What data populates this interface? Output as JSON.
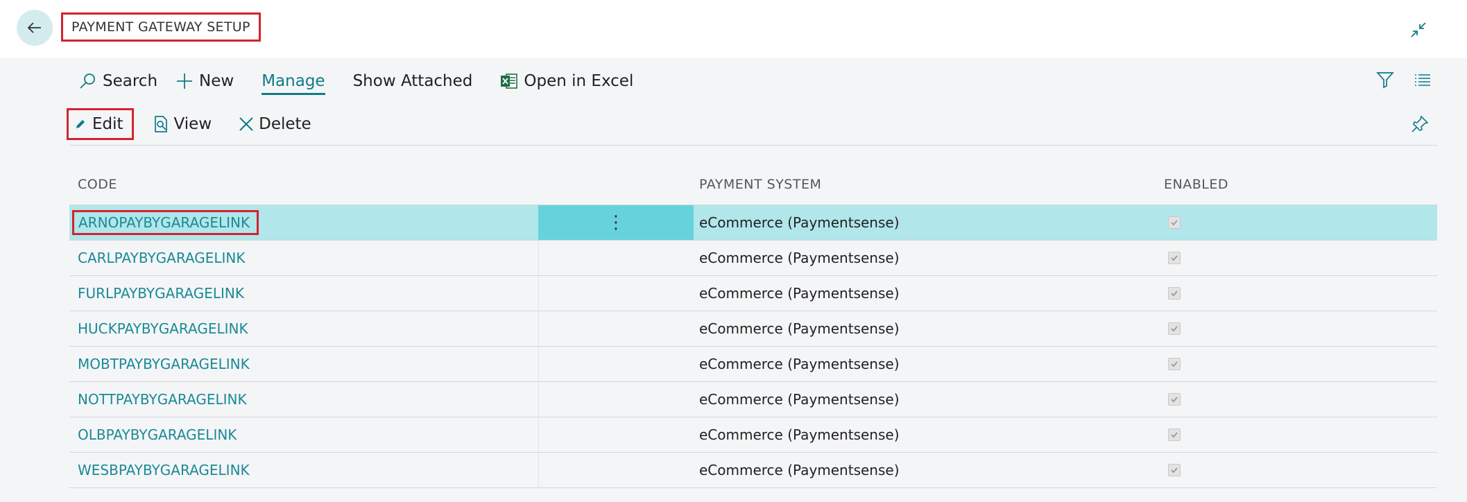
{
  "header": {
    "title": "PAYMENT GATEWAY SETUP"
  },
  "actions": {
    "search": "Search",
    "new": "New",
    "manage": "Manage",
    "show_attached": "Show Attached",
    "open_in_excel": "Open in Excel"
  },
  "subactions": {
    "edit": "Edit",
    "view": "View",
    "delete": "Delete"
  },
  "table": {
    "columns": [
      "CODE",
      "PAYMENT SYSTEM",
      "ENABLED"
    ],
    "rows": [
      {
        "code": "ARNOPAYBYGARAGELINK",
        "system": "eCommerce (Paymentsense)",
        "enabled": true
      },
      {
        "code": "CARLPAYBYGARAGELINK",
        "system": "eCommerce (Paymentsense)",
        "enabled": true
      },
      {
        "code": "FURLPAYBYGARAGELINK",
        "system": "eCommerce (Paymentsense)",
        "enabled": true
      },
      {
        "code": "HUCKPAYBYGARAGELINK",
        "system": "eCommerce (Paymentsense)",
        "enabled": true
      },
      {
        "code": "MOBTPAYBYGARAGELINK",
        "system": "eCommerce (Paymentsense)",
        "enabled": true
      },
      {
        "code": "NOTTPAYBYGARAGELINK",
        "system": "eCommerce (Paymentsense)",
        "enabled": true
      },
      {
        "code": "OLBPAYBYGARAGELINK",
        "system": "eCommerce (Paymentsense)",
        "enabled": true
      },
      {
        "code": "WESBPAYBYGARAGELINK",
        "system": "eCommerce (Paymentsense)",
        "enabled": true
      }
    ],
    "row_menu_glyph": "⋮"
  },
  "icons": {
    "back": "back-arrow-icon",
    "collapse": "collapse-icon",
    "search": "search-icon",
    "new": "plus-icon",
    "excel": "excel-icon",
    "filter": "filter-icon",
    "list": "list-icon",
    "edit": "pencil-icon",
    "view": "view-icon",
    "delete": "close-icon",
    "pin": "pin-icon"
  },
  "colors": {
    "accent": "#0f7b87",
    "link": "#1a8a95",
    "selected_row": "#b1e6ea",
    "selected_menu": "#66d3dc",
    "highlight_border": "#d3232e"
  }
}
